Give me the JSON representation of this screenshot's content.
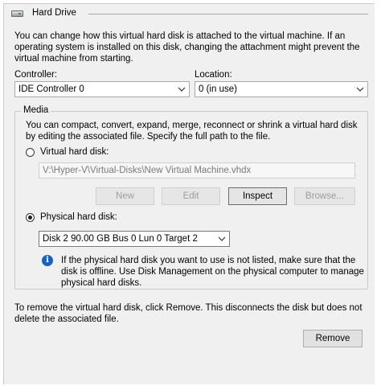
{
  "section": {
    "title": "Hard Drive"
  },
  "intro": {
    "lines": [
      "You can change how this virtual hard disk is attached to the virtual machine. If an",
      "operating system is installed on this disk, changing the attachment might prevent the",
      "virtual machine from starting."
    ]
  },
  "controller": {
    "label": "Controller:",
    "value": "IDE Controller 0"
  },
  "location": {
    "label": "Location:",
    "value": "0 (in use)"
  },
  "media": {
    "title": "Media",
    "description": [
      "You can compact, convert, expand, merge, reconnect or shrink a virtual hard disk",
      "by editing the associated file. Specify the full path to the file."
    ],
    "virtual_option": {
      "label": "Virtual hard disk:",
      "checked": false
    },
    "path_value": "V:\\Hyper-V\\Virtual-Disks\\New Virtual Machine.vhdx",
    "buttons": {
      "new": "New",
      "edit": "Edit",
      "inspect": "Inspect",
      "browse": "Browse..."
    },
    "physical_option": {
      "label": "Physical hard disk:",
      "checked": true
    },
    "physical_value": "Disk 2 90.00 GB Bus 0 Lun 0 Target 2",
    "info_icon": "info-icon",
    "info_lines": [
      "If the physical hard disk you want to use is not listed, make sure that the",
      "disk is offline. Use Disk Management on the physical computer to manage",
      "physical hard disks."
    ]
  },
  "remove_note": [
    "To remove the virtual hard disk, click Remove. This disconnects the disk but does not",
    "delete the associated file."
  ],
  "remove_button": "Remove",
  "colors": {
    "panel": "#f0f0f0",
    "info": "#1565c0",
    "border": "#a8a8a8"
  }
}
